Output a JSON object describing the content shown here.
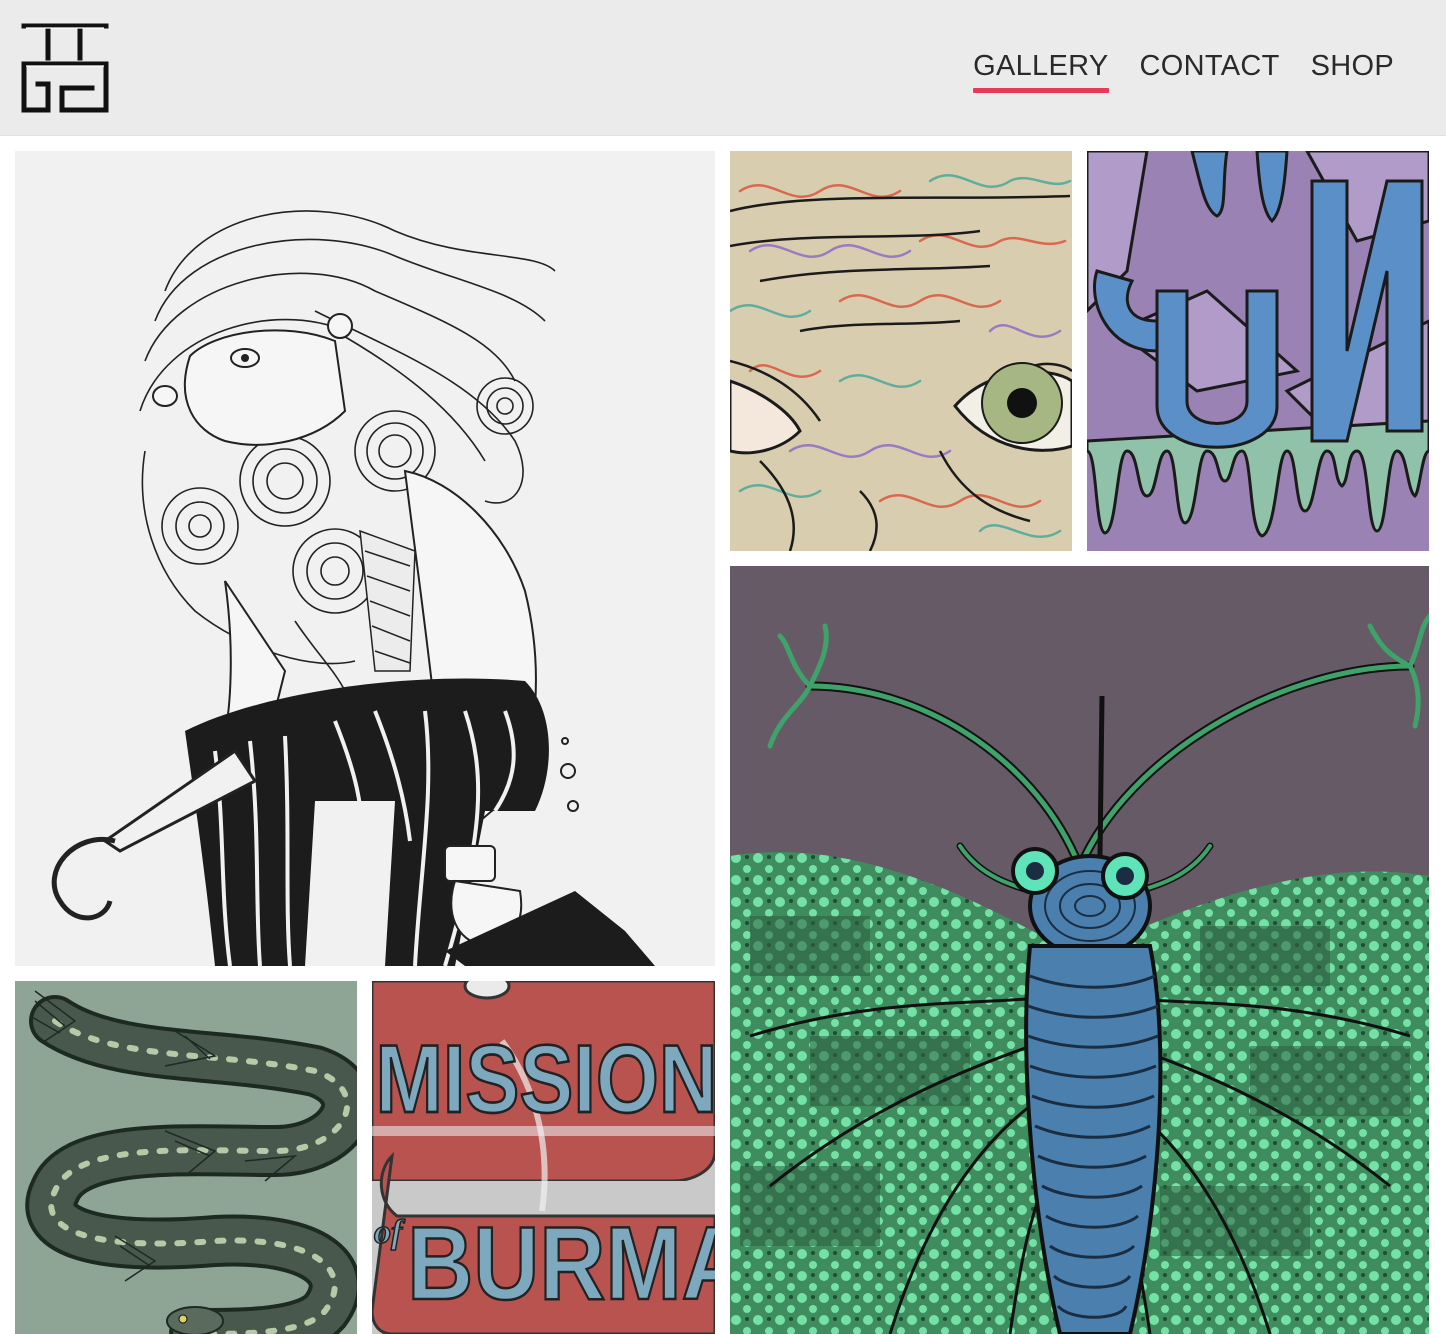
{
  "brand": {
    "logo_icon": "stylized-hh-monogram-logo"
  },
  "nav": {
    "items": [
      {
        "label": "GALLERY",
        "active": true
      },
      {
        "label": "CONTACT",
        "active": false
      },
      {
        "label": "SHOP",
        "active": false
      }
    ],
    "accent_color": "#e8395b"
  },
  "gallery": {
    "tiles": [
      {
        "subject": "bearded-man-with-umbrella-illustration"
      },
      {
        "subject": "swirly-skin-eye-closeup-illustration"
      },
      {
        "subject": "dripping-blue-lettering-illustration"
      },
      {
        "subject": "green-moth-illustration"
      },
      {
        "subject": "spotted-eel-illustration"
      },
      {
        "subject": "band-poster-illustration",
        "text_line1": "MISSION",
        "text_of": "of",
        "text_line2": "BURMA"
      }
    ]
  }
}
